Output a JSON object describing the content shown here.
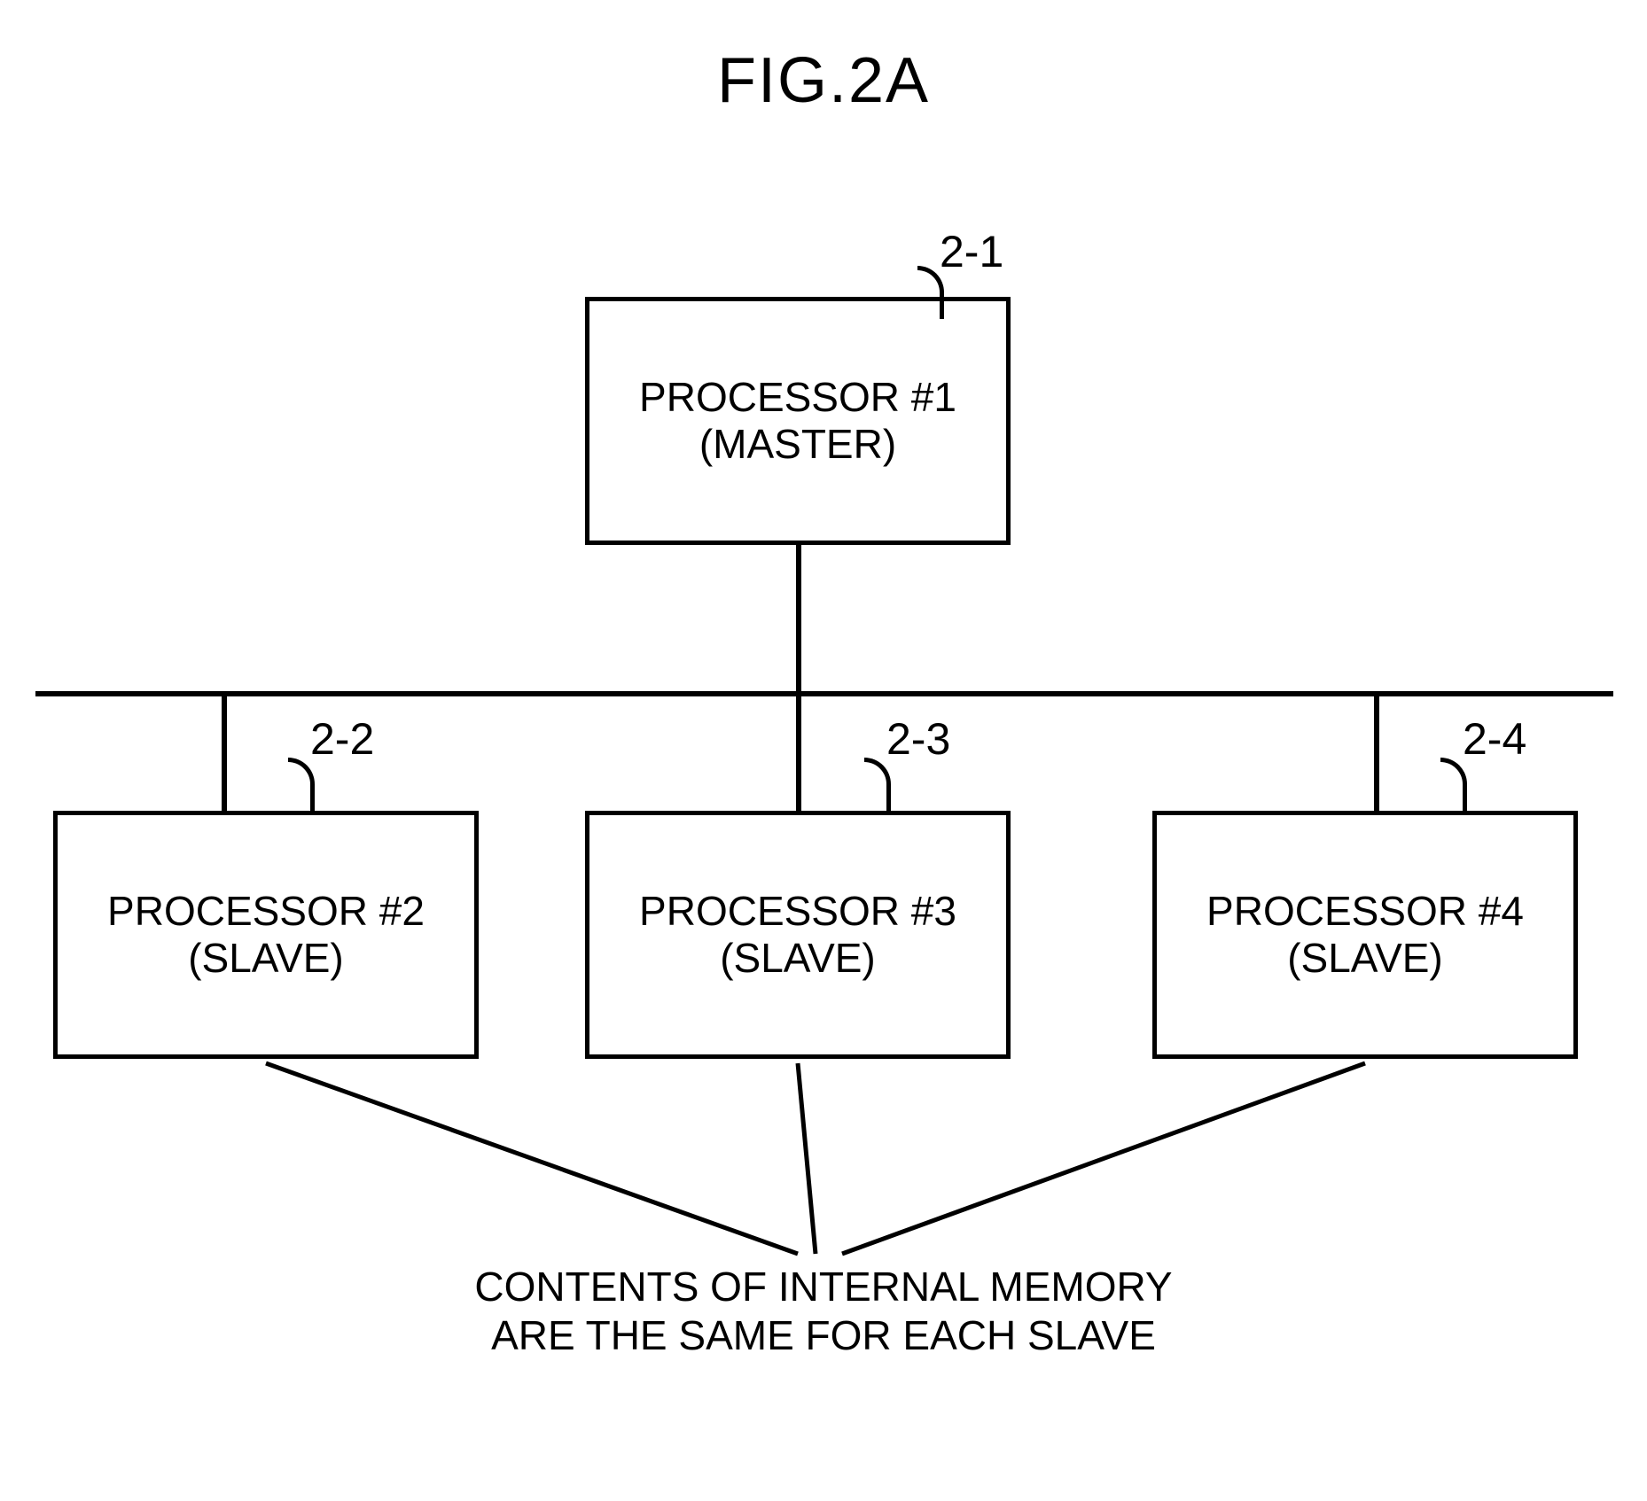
{
  "figure_title": "FIG.2A",
  "master": {
    "ref": "2-1",
    "line1": "PROCESSOR #1",
    "line2": "(MASTER)"
  },
  "slaves": [
    {
      "ref": "2-2",
      "line1": "PROCESSOR #2",
      "line2": "(SLAVE)"
    },
    {
      "ref": "2-3",
      "line1": "PROCESSOR #3",
      "line2": "(SLAVE)"
    },
    {
      "ref": "2-4",
      "line1": "PROCESSOR #4",
      "line2": "(SLAVE)"
    }
  ],
  "caption_line1": "CONTENTS OF INTERNAL MEMORY",
  "caption_line2": "ARE THE SAME FOR EACH SLAVE"
}
